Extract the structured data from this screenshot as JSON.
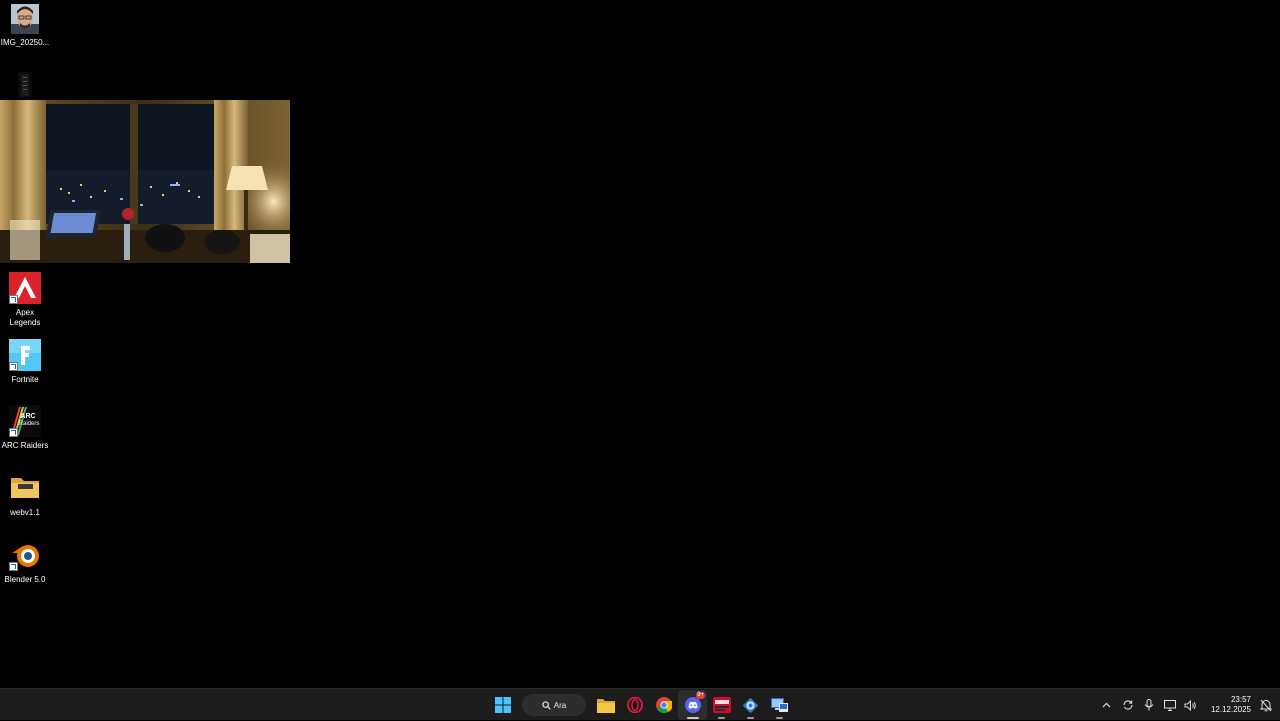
{
  "desktop": {
    "icons": [
      {
        "label": "IMG_20250...",
        "icon": "portrait-photo-icon"
      },
      {
        "label": "",
        "icon": "dark-phone-photo-icon"
      },
      {
        "label": "Apex\nLegends",
        "icon": "apex-legends-icon"
      },
      {
        "label": "Fortnite",
        "icon": "fortnite-icon"
      },
      {
        "label": "ARC Raiders",
        "icon": "arc-raiders-icon"
      },
      {
        "label": "webv1.1",
        "icon": "folder-icon"
      },
      {
        "label": "Blender 5.0",
        "icon": "blender-icon"
      }
    ],
    "arc_logo_text": "ARC Raiders",
    "photo_widget": {
      "description_icon": "hotel-room-night-view-image"
    }
  },
  "taskbar": {
    "search_label": "Ara",
    "apps": [
      {
        "name": "start-button",
        "icon": "windows-logo-icon"
      },
      {
        "name": "file-explorer",
        "icon": "folder-icon"
      },
      {
        "name": "opera-gx",
        "icon": "opera-icon"
      },
      {
        "name": "chrome",
        "icon": "chrome-icon"
      },
      {
        "name": "discord",
        "icon": "discord-icon",
        "badge": "9+"
      },
      {
        "name": "game-app",
        "icon": "red-game-app-icon"
      },
      {
        "name": "network-app",
        "icon": "network-globe-icon"
      },
      {
        "name": "remote-desktop",
        "icon": "remote-desktop-icon"
      }
    ],
    "tray": {
      "icons": [
        "chevron-up-icon",
        "sync-icon",
        "microphone-icon",
        "network-icon",
        "volume-icon",
        "notification-icon"
      ],
      "time": "23:57",
      "date": "12.12.2025"
    }
  },
  "colors": {
    "desktop_bg": "#000000",
    "taskbar_bg": "#1c1c1c",
    "apex_red": "#d9222a",
    "fortnite_blue": "#54c7f2",
    "folder_yellow": "#f0c75e",
    "blender_orange": "#ea7600",
    "discord_blurple": "#5865f2"
  }
}
